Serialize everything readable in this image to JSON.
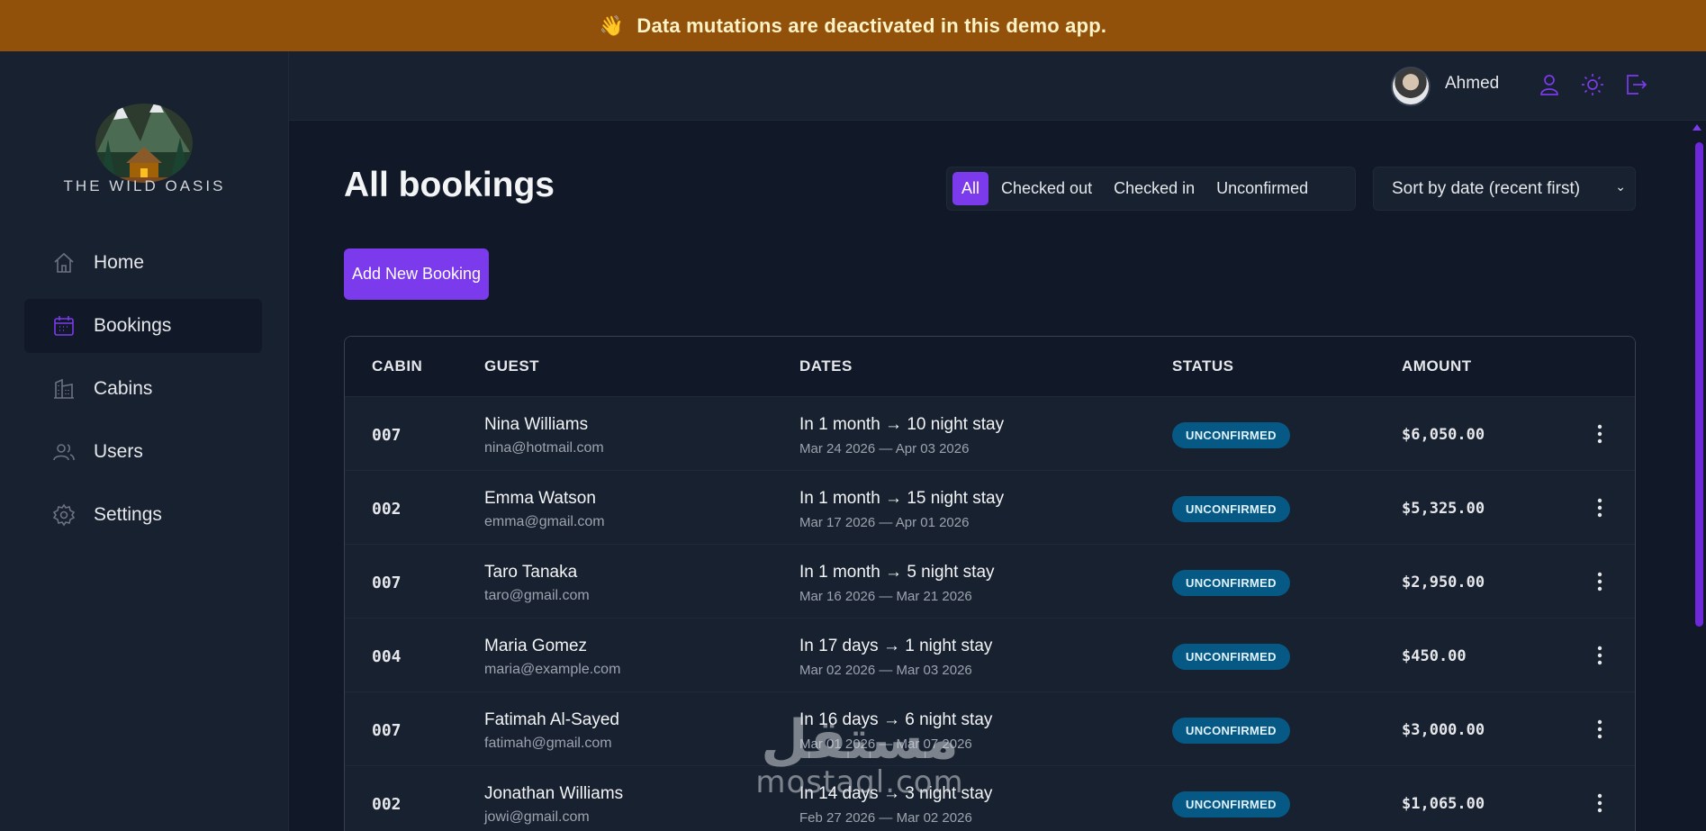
{
  "banner": {
    "icon": "waving-hand-icon",
    "text": "Data mutations are deactivated in this demo app."
  },
  "brand": {
    "name": "THE WILD OASIS"
  },
  "sidebar": {
    "items": [
      {
        "label": "Home",
        "icon": "home-icon",
        "active": false
      },
      {
        "label": "Bookings",
        "icon": "calendar-icon",
        "active": true
      },
      {
        "label": "Cabins",
        "icon": "cabins-icon",
        "active": false
      },
      {
        "label": "Users",
        "icon": "users-icon",
        "active": false
      },
      {
        "label": "Settings",
        "icon": "gear-icon",
        "active": false
      }
    ]
  },
  "header": {
    "username": "Ahmed",
    "icons": [
      "user-icon",
      "sun-icon",
      "logout-icon"
    ]
  },
  "main": {
    "title": "All bookings",
    "filters": [
      "All",
      "Checked out",
      "Checked in",
      "Unconfirmed"
    ],
    "active_filter": "All",
    "sort_label": "Sort by date (recent first)",
    "add_button": "Add New Booking",
    "table": {
      "columns": [
        "CABIN",
        "GUEST",
        "DATES",
        "STATUS",
        "AMOUNT"
      ],
      "rows": [
        {
          "cabin": "007",
          "name": "Nina Williams",
          "email": "nina@hotmail.com",
          "when": "In 1 month → 10 night stay",
          "range": "Mar 24 2026 — Apr 03 2026",
          "status": "UNCONFIRMED",
          "amount": "$6,050.00"
        },
        {
          "cabin": "002",
          "name": "Emma Watson",
          "email": "emma@gmail.com",
          "when": "In 1 month → 15 night stay",
          "range": "Mar 17 2026 — Apr 01 2026",
          "status": "UNCONFIRMED",
          "amount": "$5,325.00"
        },
        {
          "cabin": "007",
          "name": "Taro Tanaka",
          "email": "taro@gmail.com",
          "when": "In 1 month → 5 night stay",
          "range": "Mar 16 2026 — Mar 21 2026",
          "status": "UNCONFIRMED",
          "amount": "$2,950.00"
        },
        {
          "cabin": "004",
          "name": "Maria Gomez",
          "email": "maria@example.com",
          "when": "In 17 days → 1 night stay",
          "range": "Mar 02 2026 — Mar 03 2026",
          "status": "UNCONFIRMED",
          "amount": "$450.00"
        },
        {
          "cabin": "007",
          "name": "Fatimah Al-Sayed",
          "email": "fatimah@gmail.com",
          "when": "In 16 days → 6 night stay",
          "range": "Mar 01 2026 — Mar 07 2026",
          "status": "UNCONFIRMED",
          "amount": "$3,000.00"
        },
        {
          "cabin": "002",
          "name": "Jonathan Williams",
          "email": "jowi@gmail.com",
          "when": "In 14 days → 3 night stay",
          "range": "Feb 27 2026 — Mar 02 2026",
          "status": "UNCONFIRMED",
          "amount": "$1,065.00"
        }
      ]
    }
  },
  "watermark": {
    "arabic": "مستقل",
    "latin": "mostaql.com"
  },
  "colors": {
    "accent": "#7c3aed",
    "banner": "#92510a",
    "status_badge": "#075985",
    "background": "#111827",
    "surface": "#18212f"
  }
}
